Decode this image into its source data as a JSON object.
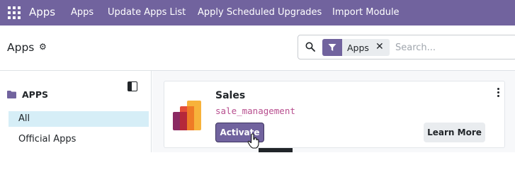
{
  "navbar": {
    "brand": "Apps",
    "menus": [
      "Apps",
      "Update Apps List",
      "Apply Scheduled Upgrades",
      "Import Module"
    ],
    "color": "#71639e"
  },
  "control_panel": {
    "title": "Apps",
    "facet_label": "Apps",
    "search_placeholder": "Search..."
  },
  "sidebar": {
    "header": "APPS",
    "items": [
      {
        "label": "All",
        "active": true
      },
      {
        "label": "Official Apps",
        "active": false
      }
    ]
  },
  "app_card": {
    "name": "Sales",
    "technical_name": "sale_management",
    "activate_label": "Activate",
    "learn_more_label": "Learn More"
  }
}
